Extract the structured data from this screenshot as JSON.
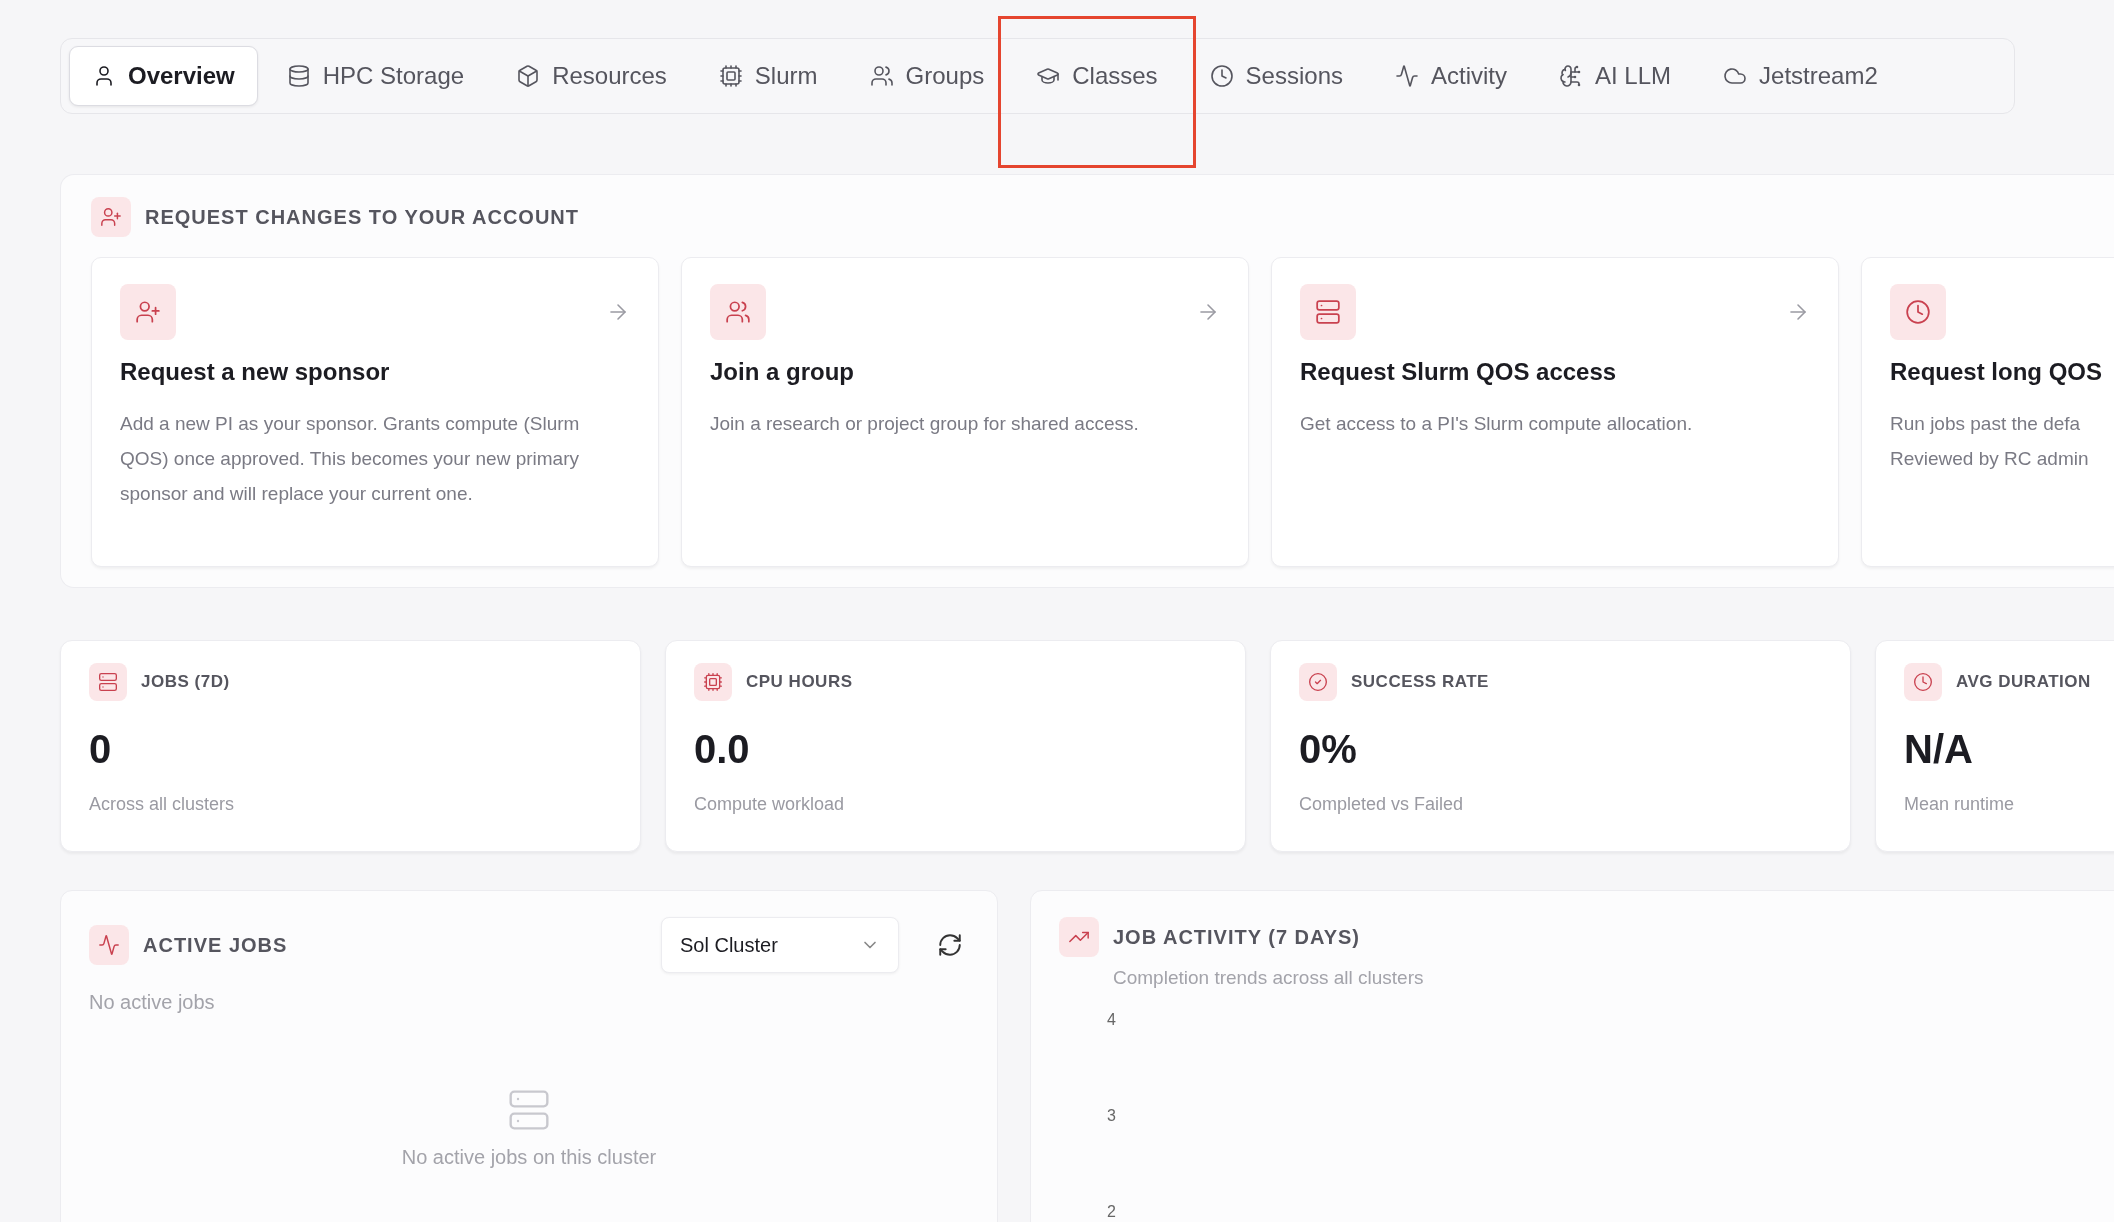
{
  "tabs": [
    {
      "label": "Overview",
      "selected": true,
      "highlighted": false
    },
    {
      "label": "HPC Storage",
      "selected": false,
      "highlighted": false
    },
    {
      "label": "Resources",
      "selected": false,
      "highlighted": false
    },
    {
      "label": "Slurm",
      "selected": false,
      "highlighted": false
    },
    {
      "label": "Groups",
      "selected": false,
      "highlighted": false
    },
    {
      "label": "Classes",
      "selected": false,
      "highlighted": true
    },
    {
      "label": "Sessions",
      "selected": false,
      "highlighted": false
    },
    {
      "label": "Activity",
      "selected": false,
      "highlighted": false
    },
    {
      "label": "AI LLM",
      "selected": false,
      "highlighted": false
    },
    {
      "label": "Jetstream2",
      "selected": false,
      "highlighted": false
    }
  ],
  "requests": {
    "title": "REQUEST CHANGES TO YOUR ACCOUNT",
    "cards": [
      {
        "title": "Request a new sponsor",
        "description": "Add a new PI as your sponsor. Grants compute (Slurm QOS) once approved. This becomes your new primary sponsor and will replace your current one.",
        "arrow": true
      },
      {
        "title": "Join a group",
        "description": "Join a research or project group for shared access.",
        "arrow": true
      },
      {
        "title": "Request Slurm QOS access",
        "description": "Get access to a PI's Slurm compute allocation.",
        "arrow": true
      },
      {
        "title": "Request long QOS",
        "description": "Run jobs past the defa\nReviewed by RC admin",
        "arrow": false
      }
    ]
  },
  "stats": [
    {
      "label": "JOBS (7D)",
      "value": "0",
      "caption": "Across all clusters"
    },
    {
      "label": "CPU HOURS",
      "value": "0.0",
      "caption": "Compute workload"
    },
    {
      "label": "SUCCESS RATE",
      "value": "0%",
      "caption": "Completed vs Failed"
    },
    {
      "label": "AVG DURATION",
      "value": "N/A",
      "caption": "Mean runtime"
    }
  ],
  "active_jobs": {
    "title": "ACTIVE JOBS",
    "cluster": "Sol Cluster",
    "status": "No active jobs",
    "empty_message": "No active jobs on this cluster"
  },
  "job_activity": {
    "title": "JOB ACTIVITY (7 DAYS)",
    "subtitle": "Completion trends across all clusters",
    "y_ticks": [
      "4",
      "3",
      "2"
    ]
  }
}
